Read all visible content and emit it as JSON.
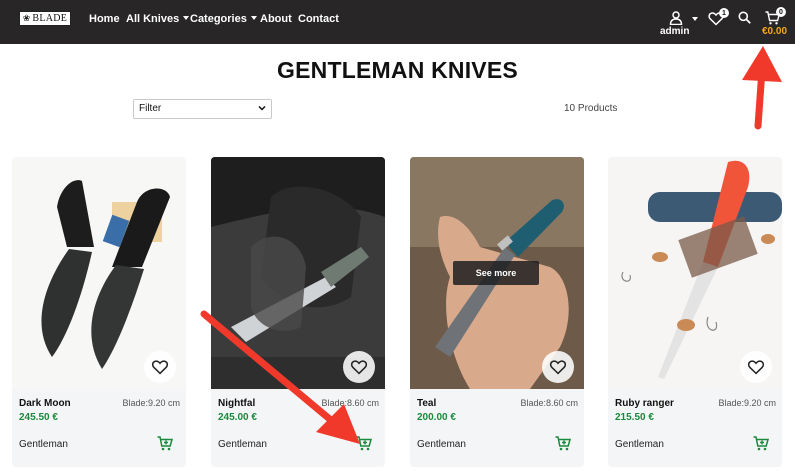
{
  "navbar": {
    "logo_text": "BLADE",
    "links": {
      "home": "Home",
      "all_knives": "All Knives",
      "categories": "Categories",
      "about": "About",
      "contact": "Contact"
    },
    "user_label": "admin",
    "wishlist_count": "1",
    "cart_count": "0",
    "cart_total": "€0.00",
    "icons": [
      "user-icon",
      "heart-icon",
      "search-icon",
      "cart-icon"
    ]
  },
  "page": {
    "title": "GENTLEMAN KNIVES",
    "filter_value": "Filter",
    "product_count": "10 Products"
  },
  "products": [
    {
      "name": "Dark Moon",
      "blade": "Blade:9.20 cm",
      "price": "245.50 €",
      "category": "Gentleman"
    },
    {
      "name": "Nightfal",
      "blade": "Blade:8.60 cm",
      "price": "245.00 €",
      "category": "Gentleman"
    },
    {
      "name": "Teal",
      "blade": "Blade:8.60 cm",
      "price": "200.00 €",
      "category": "Gentleman",
      "overlay": "See more"
    },
    {
      "name": "Ruby ranger",
      "blade": "Blade:9.20 cm",
      "price": "215.50 €",
      "category": "Gentleman"
    }
  ],
  "colors": {
    "navbar_bg": "#282626",
    "price_green": "#1b8a3d",
    "cart_total_orange": "#f5a623",
    "annotation_red": "#f0392b"
  }
}
